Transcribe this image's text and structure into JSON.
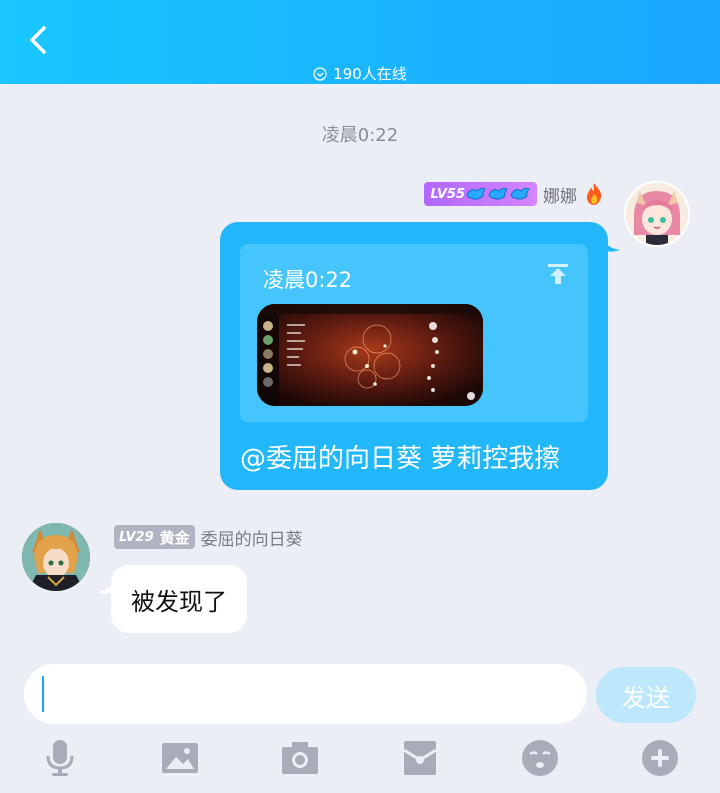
{
  "header": {
    "online_text": "190人在线",
    "bg_color_start": "#19c6ff",
    "bg_color_end": "#1aa6ff"
  },
  "chat": {
    "timestamp": "凌晨0:22",
    "my_message": {
      "level": "LV55",
      "sender": "娜娜",
      "card_time": "凌晨0:22",
      "mention_text": "@委屈的向日葵 萝莉控我擦",
      "bubble_color": "#21b7f9"
    },
    "other_message": {
      "level": "LV29",
      "title": "黄金",
      "sender": "委屈的向日葵",
      "text": "被发现了"
    }
  },
  "input": {
    "placeholder": "",
    "send_label": "发送"
  },
  "toolbar": {
    "icons": [
      "mic-icon",
      "image-icon",
      "camera-icon",
      "redpacket-icon",
      "emoji-icon",
      "plus-icon"
    ]
  }
}
